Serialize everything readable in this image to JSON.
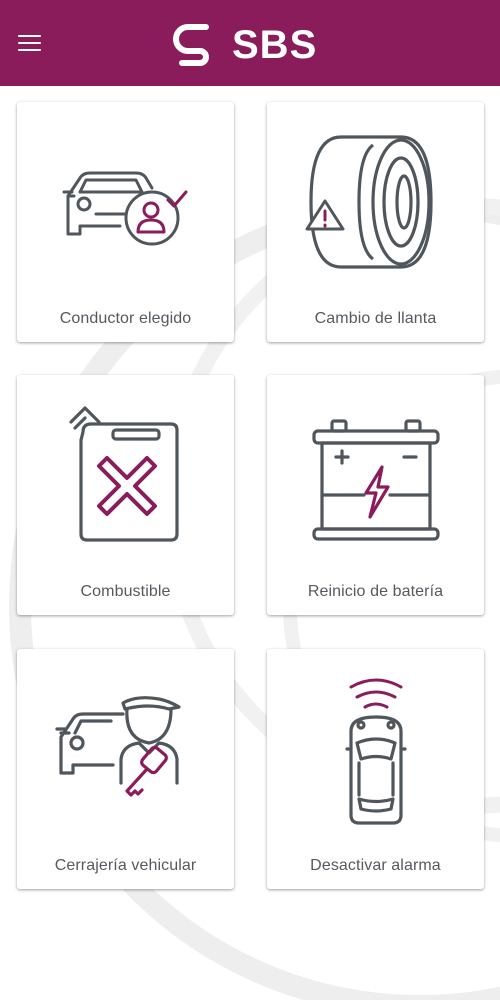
{
  "header": {
    "brand": "SBS",
    "menu_icon": "hamburger-menu-icon",
    "logo_icon": "sbs-logo-icon"
  },
  "colors": {
    "brand": "#8a1c5b",
    "icon_stroke": "#4f565c",
    "accent": "#8a1c5b",
    "label": "#555a5f"
  },
  "services": [
    {
      "label": "Conductor elegido",
      "icon": "car-driver-check-icon"
    },
    {
      "label": "Cambio de llanta",
      "icon": "tire-warning-icon"
    },
    {
      "label": "Combustible",
      "icon": "fuel-can-icon"
    },
    {
      "label": "Reinicio de batería",
      "icon": "battery-bolt-icon"
    },
    {
      "label": "Cerrajería vehicular",
      "icon": "car-locksmith-key-icon"
    },
    {
      "label": "Desactivar alarma",
      "icon": "car-alarm-signal-icon"
    }
  ]
}
